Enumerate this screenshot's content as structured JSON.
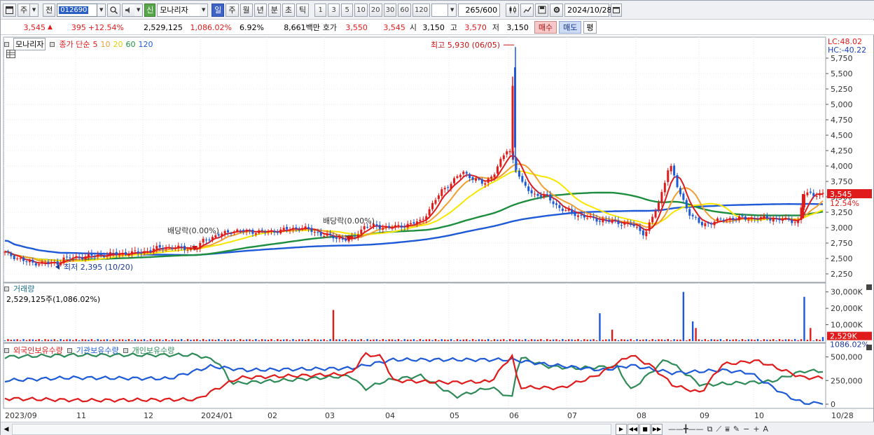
{
  "toolbar": {
    "market_type": "주",
    "prev_label": "전",
    "stock_code": "012690",
    "sin_label": "신",
    "stock_name": "모나리자",
    "periods": [
      "일",
      "주",
      "월",
      "년",
      "분",
      "초",
      "틱"
    ],
    "active_period": "일",
    "intervals": [
      "1",
      "3",
      "5",
      "10",
      "20",
      "30",
      "60",
      "120"
    ],
    "count": "265",
    "count_total": "/600",
    "date": "2024/10/28"
  },
  "quote": {
    "price": "3,545",
    "change": "395",
    "change_pct": "+12.54%",
    "volume": "2,529,125",
    "volume_pct": "1,086.02%",
    "turnover": "6.92%",
    "amount": "8,661백만",
    "ask_label": "호가",
    "ask_price": "3,550",
    "bid_price": "3,545",
    "open_label": "시",
    "open": "3,150",
    "high_label": "고",
    "high": "3,570",
    "low_label": "저",
    "low": "3,150",
    "buy_label": "매수",
    "sell_label": "매도",
    "avg_label": "평"
  },
  "price_panel": {
    "name": "모나리자",
    "legend_label": "종가 단순",
    "ma_periods": [
      "5",
      "10",
      "20",
      "60",
      "120"
    ],
    "ma_colors": [
      "#e01b1b",
      "#f0a030",
      "#f7e600",
      "#1e8e3e",
      "#1e5ad8"
    ],
    "lc": "LC:48.02",
    "hc": "HC:-40.22",
    "current_price_label": "3,545",
    "current_pct_label": "12.54%",
    "y_ticks": [
      "5,750",
      "5,500",
      "5,250",
      "5,000",
      "4,750",
      "4,500",
      "4,250",
      "4,000",
      "3,750",
      "3,500",
      "3,250",
      "3,000",
      "2,750",
      "2,500",
      "2,250"
    ],
    "high_annotation": "최고 5,930 (06/05)",
    "low_annotation": "최저 2,395 (10/20)",
    "dividend_1": "배당락(0.00%)",
    "dividend_2": "배당락(0.00%)"
  },
  "volume_panel": {
    "title": "거래량",
    "current": "2,529,125주(1,086.02%)",
    "y_ticks": [
      "30,000K",
      "20,000K",
      "10,000K"
    ],
    "current_label": "2,529K",
    "current_pct_label": "1086.02%"
  },
  "holding_panel": {
    "series": [
      "외국인보유수량",
      "기관보유수량",
      "개인보유수량"
    ],
    "colors": [
      "#e01b1b",
      "#1e5ad8",
      "#2e8b57"
    ],
    "y_ticks": [
      "500,000",
      "250,000",
      "0"
    ]
  },
  "x_axis": {
    "labels": [
      "2023/09",
      "11",
      "12",
      "2024/01",
      "02",
      "03",
      "04",
      "05",
      "06",
      "07",
      "08",
      "09",
      "10",
      "10/28"
    ]
  },
  "chart_data": {
    "type": "candlestick",
    "title": "모나리자",
    "y_range": [
      2250,
      5930
    ],
    "period": "2023/09 – 2024/10/28",
    "high": {
      "value": 5930,
      "date": "06/05"
    },
    "low": {
      "value": 2395,
      "date": "10/20"
    },
    "last_close": 3545,
    "volume_last": 2529125,
    "series": [
      {
        "name": "5",
        "values": []
      },
      {
        "name": "10",
        "values": []
      },
      {
        "name": "20",
        "values": []
      },
      {
        "name": "60",
        "values": []
      },
      {
        "name": "120",
        "values": []
      }
    ]
  }
}
